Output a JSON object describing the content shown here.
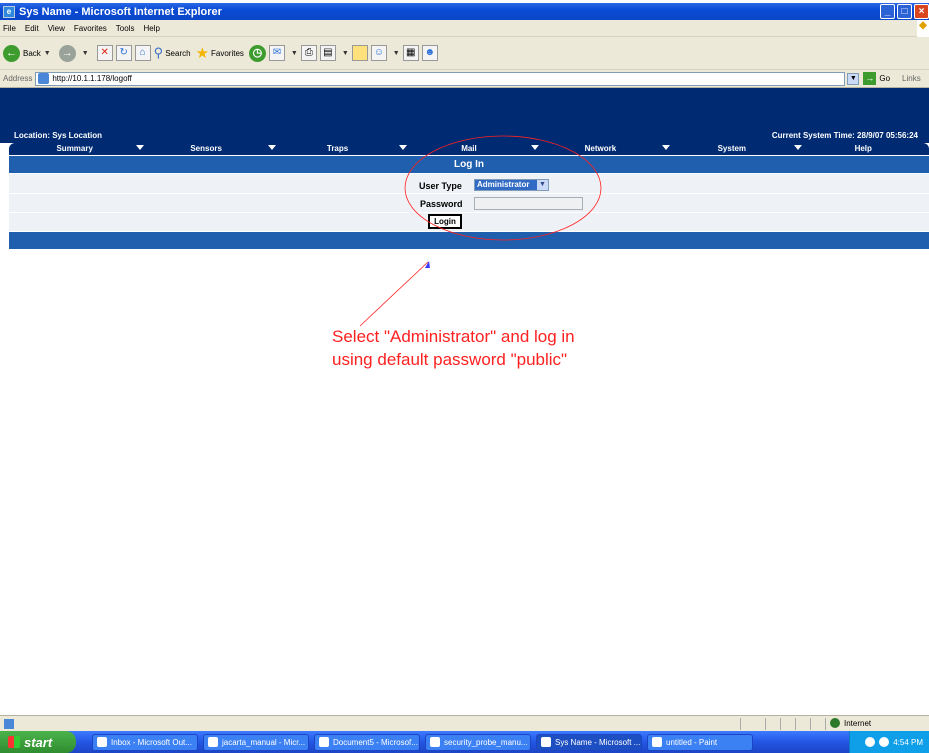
{
  "window": {
    "title": "Sys Name - Microsoft Internet Explorer"
  },
  "menu": [
    "File",
    "Edit",
    "View",
    "Favorites",
    "Tools",
    "Help"
  ],
  "toolbar": {
    "back": "Back",
    "search": "Search",
    "favorites": "Favorites"
  },
  "address": {
    "label": "Address",
    "url": "http://10.1.1.178/logoff",
    "go": "Go",
    "links": "Links"
  },
  "page": {
    "location": "Location: Sys Location",
    "current_time": "Current System Time: 28/9/07 05:56:24",
    "nav": [
      "Summary",
      "Sensors",
      "Traps",
      "Mail",
      "Network",
      "System",
      "Help"
    ],
    "login": {
      "title": "Log In",
      "user_type_label": "User Type",
      "user_type_value": "Administrator",
      "password_label": "Password",
      "login_button": "Login"
    }
  },
  "annotation": {
    "line1": "Select \"Administrator\" and log in",
    "line2": "using default password \"public\"",
    "color": "#ff2020"
  },
  "status": {
    "zone": "Internet"
  },
  "taskbar": {
    "start": "start",
    "tasks": [
      "Inbox - Microsoft Out...",
      "jacarta_manual - Micr...",
      "Document5 - Microsof...",
      "security_probe_manu...",
      "Sys Name - Microsoft ...",
      "untitled - Paint"
    ],
    "clock": "4:54 PM"
  }
}
